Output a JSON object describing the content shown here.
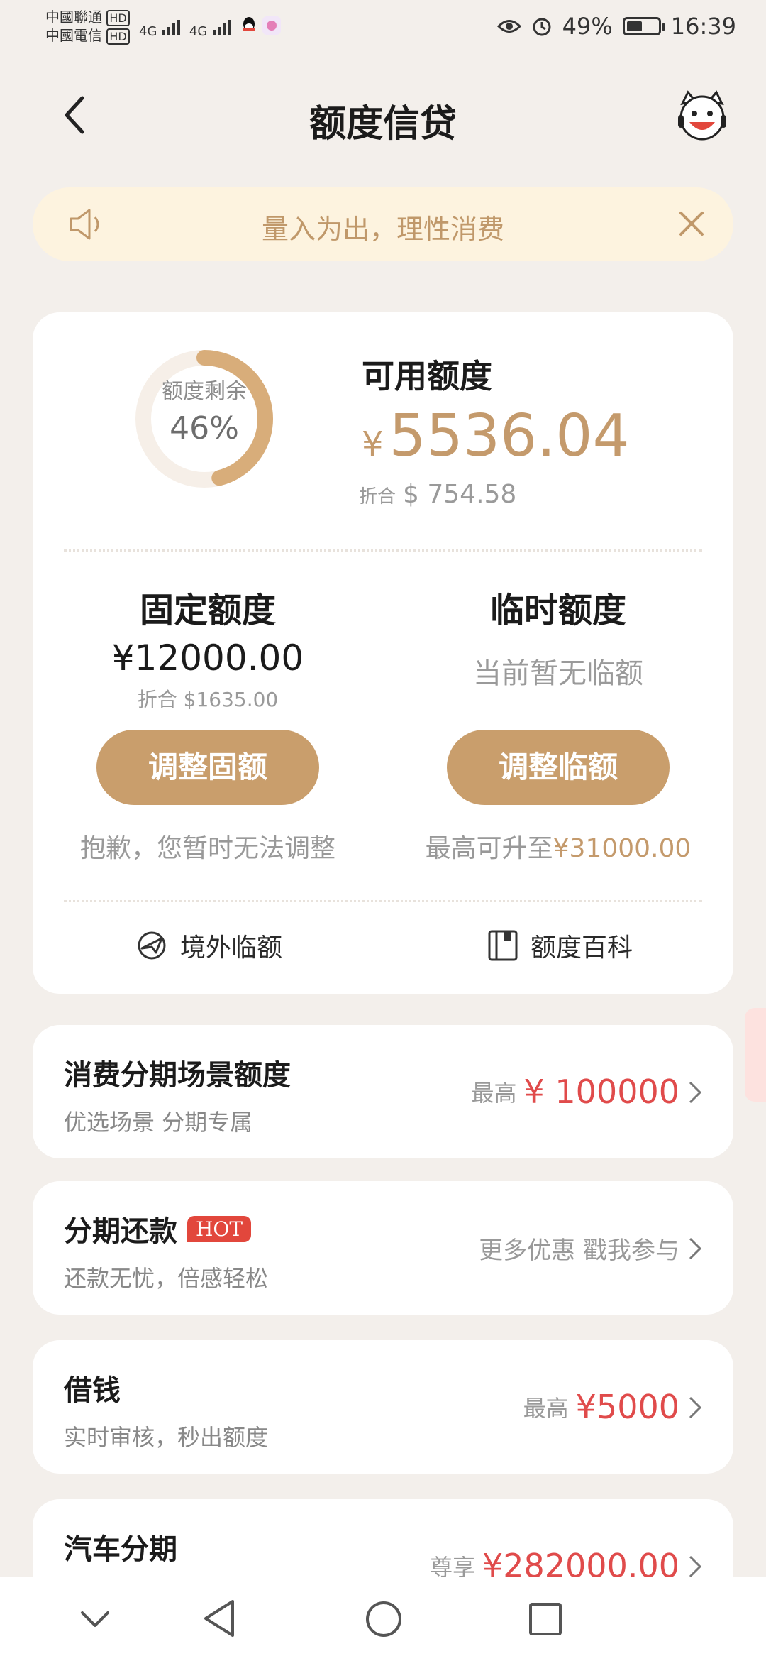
{
  "status_bar": {
    "carrier1": "中國聯通",
    "carrier2": "中國電信",
    "hd": "HD",
    "net": "4G",
    "battery_text": "49%",
    "battery_level": 0.49,
    "time": "16:39"
  },
  "header": {
    "title": "额度信贷"
  },
  "notice": {
    "text": "量入为出，理性消费"
  },
  "summary": {
    "ring_label": "额度剩余",
    "ring_percent_text": "46%",
    "ring_percent": 0.46,
    "available_title": "可用额度",
    "currency": "¥",
    "available_amount": "5536.04",
    "usd_prefix": "折合",
    "usd_amount": "$ 754.58"
  },
  "fixed": {
    "title": "固定额度",
    "amount": "¥12000.00",
    "usd": "折合 $1635.00",
    "button": "调整固额",
    "note": "抱歉，您暂时无法调整"
  },
  "temp": {
    "title": "临时额度",
    "empty": "当前暂无临额",
    "button": "调整临额",
    "note_prefix": "最高可升至",
    "note_amount": "¥31000.00"
  },
  "links": {
    "overseas": "境外临额",
    "wiki": "额度百科"
  },
  "rows": [
    {
      "title": "消费分期场景额度",
      "subtitle": "优选场景 分期专属",
      "right_prefix": "最高",
      "right_amount": "¥ 100000"
    },
    {
      "title": "分期还款",
      "badge": "HOT",
      "subtitle": "还款无忧，倍感轻松",
      "right_text": "更多优惠 戳我参与"
    },
    {
      "title": "借钱",
      "subtitle": "实时审核，秒出额度",
      "right_prefix": "最高",
      "right_amount": "¥5000"
    },
    {
      "title": "汽车分期",
      "right_prefix": "尊享",
      "right_amount": "¥282000.00"
    }
  ],
  "colors": {
    "accent": "#c99e6c",
    "price": "#e04b4b",
    "notice_bg": "#fdf3df"
  }
}
